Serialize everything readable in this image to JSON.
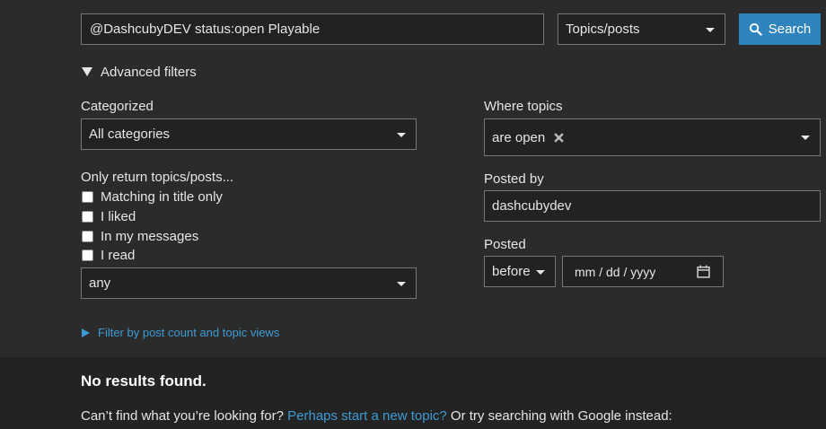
{
  "search": {
    "query": "@DashcubyDEV status:open Playable",
    "type_select": "Topics/posts",
    "button_label": "Search"
  },
  "advanced": {
    "toggle_label": "Advanced filters",
    "categorized_label": "Categorized",
    "category_value": "All categories",
    "only_return_label": "Only return topics/posts...",
    "checkboxes": [
      {
        "label": "Matching in title only"
      },
      {
        "label": "I liked"
      },
      {
        "label": "In my messages"
      },
      {
        "label": "I read"
      }
    ],
    "any_value": "any",
    "where_topics_label": "Where topics",
    "where_topics_value": "are open",
    "posted_by_label": "Posted by",
    "posted_by_value": "dashcubydev",
    "posted_label": "Posted",
    "posted_when": "before",
    "date_placeholder": "mm / dd / yyyy",
    "filter_link": "Filter by post count and topic views"
  },
  "results": {
    "heading": "No results found.",
    "cant_find": "Can’t find what you’re looking for?",
    "new_topic_link": "Perhaps start a new topic?",
    "google_text": "Or try searching with Google instead:"
  },
  "colors": {
    "background": "#2b2b2b",
    "accent": "#2f84bd",
    "link": "#3d9bd4"
  }
}
